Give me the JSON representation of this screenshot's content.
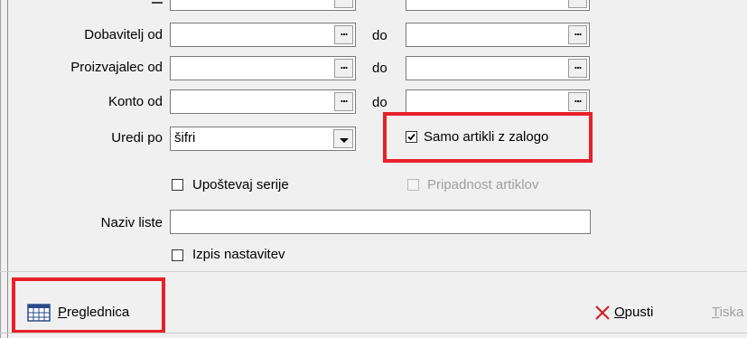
{
  "form": {
    "supplier_from_label": "Dobavitelj od",
    "supplier_from_value": "",
    "supplier_to_label": "do",
    "supplier_to_value": "",
    "producer_from_label": "Proizvajalec od",
    "producer_from_value": "",
    "producer_to_label": "do",
    "producer_to_value": "",
    "account_from_label": "Konto od",
    "account_from_value": "",
    "account_to_label": "do",
    "account_to_value": "",
    "sort_label": "Uredi po",
    "sort_value": "šifri",
    "ellipsis": "...",
    "only_in_stock_label": "Samo artikli z zalogo",
    "only_in_stock_checked": true,
    "consider_series_label": "Upoštevaj serije",
    "consider_series_checked": false,
    "article_membership_label": "Pripadnost artiklov",
    "article_membership_checked": false,
    "list_name_label": "Naziv liste",
    "list_name_value": "",
    "print_settings_label": "Izpis nastavitev",
    "print_settings_checked": false
  },
  "toolbar": {
    "browser_first": "P",
    "browser_rest": "reglednica",
    "cancel_first": "O",
    "cancel_rest": "pusti",
    "print_first": "T",
    "print_rest": "iska"
  },
  "colors": {
    "highlight": "#e8202a",
    "cancel_icon": "#d0202a",
    "table_icon": "#2a4a8a"
  }
}
